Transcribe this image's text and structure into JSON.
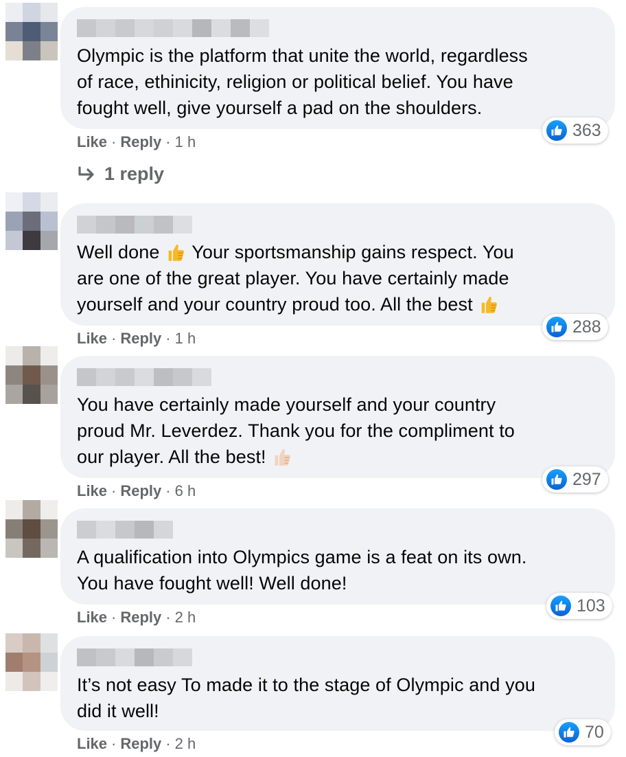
{
  "comments": [
    {
      "text_lines": [
        "Olympic is the platform that unite the world, regardless",
        "of race, ethinicity, religion or political belief. You have",
        "fought well, give yourself a pad on the shoulders."
      ],
      "like_label": "Like",
      "reply_label": "Reply",
      "time": "1 h",
      "reaction_count": "363"
    },
    {
      "text_parts": [
        "Well done ",
        " Your sportsmanship gains respect. You"
      ],
      "text_lines": [
        "are one of the great player. You have certainly made",
        "yourself and your country proud too. All the best "
      ],
      "like_label": "Like",
      "reply_label": "Reply",
      "time": "1 h",
      "reaction_count": "288"
    },
    {
      "text_lines": [
        "You have certainly made yourself and your country",
        "proud Mr. Leverdez. Thank you for the compliment to",
        "our player. All the best! "
      ],
      "like_label": "Like",
      "reply_label": "Reply",
      "time": "6 h",
      "reaction_count": "297"
    },
    {
      "text_lines": [
        "A qualification into Olympics game is a feat on its own.",
        "You have fought well! Well done!"
      ],
      "like_label": "Like",
      "reply_label": "Reply",
      "time": "2 h",
      "reaction_count": "103"
    },
    {
      "text_lines": [
        "It’s not easy To made it to the stage of Olympic and you",
        "did it well!"
      ],
      "like_label": "Like",
      "reply_label": "Reply",
      "time": "2 h",
      "reaction_count": "70"
    }
  ],
  "replies_link": "1 reply",
  "separator": "·",
  "icons": {
    "like": "thumbs-up-icon",
    "reply_arrow": "reply-arrow-icon",
    "thumb_emoji": "thumbs-up-emoji-icon"
  },
  "colors": {
    "bubble": "#f0f2f5",
    "meta_text": "#65676b",
    "like_blue": "#1877f2",
    "emoji_yellow": "#f7b928",
    "emoji_light": "#f3d3bd"
  }
}
